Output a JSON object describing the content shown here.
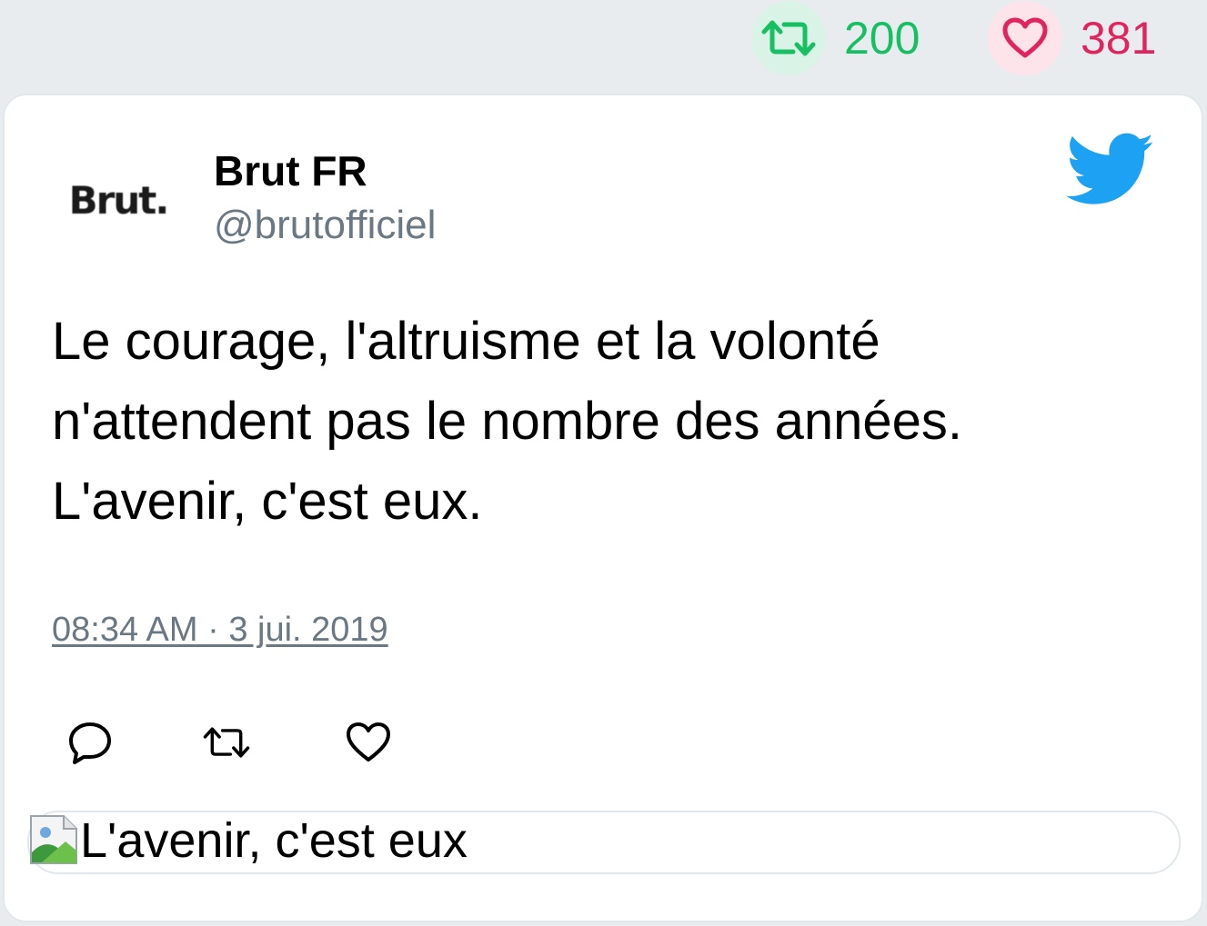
{
  "header_stats": {
    "retweet_count": "200",
    "like_count": "381",
    "retweet_icon": "retweet-icon",
    "like_icon": "heart-icon",
    "retweet_color": "#17bf63",
    "like_color": "#e0245e"
  },
  "tweet": {
    "avatar_text": "Brut.",
    "author_name": "Brut FR",
    "author_handle": "@brutofficiel",
    "brand_icon": "twitter-bird-icon",
    "brand_color": "#1da1f2",
    "text_lines": [
      "Le courage, l'altruisme et la volonté",
      "n'attendent pas le nombre des années.",
      "L'avenir, c'est eux."
    ],
    "timestamp": "08:34 AM · 3 jui. 2019",
    "actions": {
      "reply_icon": "reply-icon",
      "retweet_icon": "retweet-icon",
      "like_icon": "heart-icon"
    },
    "media": {
      "alt_text": "L'avenir, c'est eux",
      "icon": "broken-image-icon"
    }
  }
}
